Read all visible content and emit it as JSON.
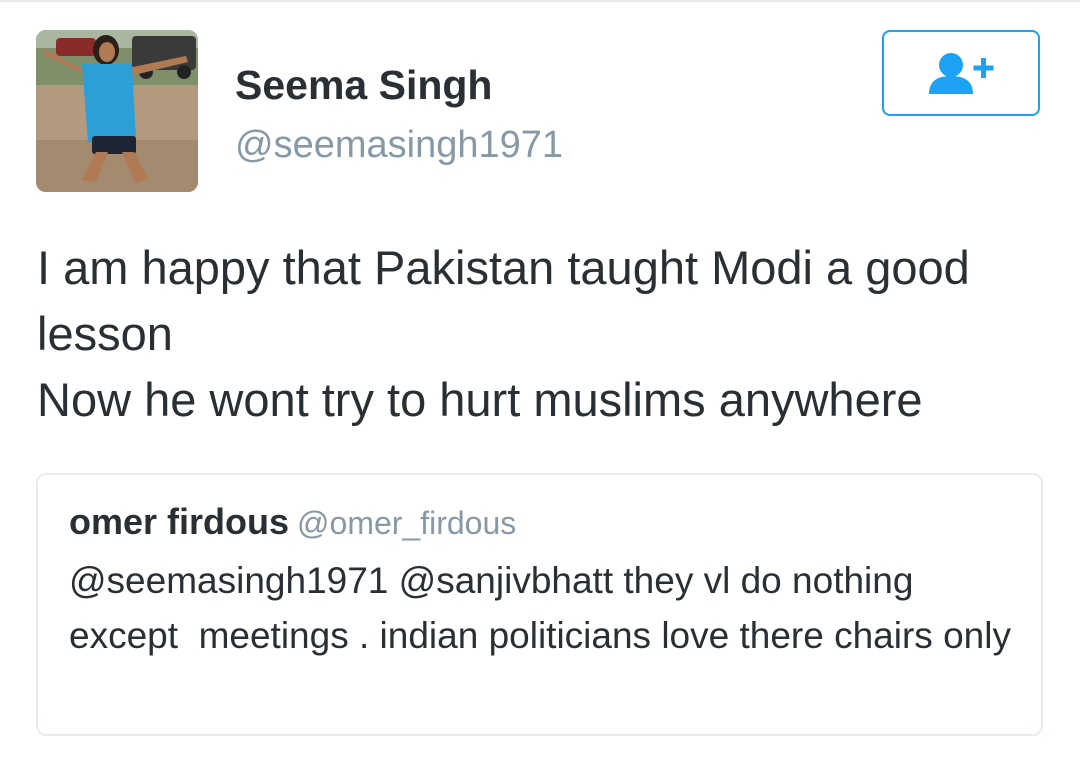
{
  "tweet": {
    "author": {
      "display_name": "Seema Singh",
      "handle": "@seemasingh1971",
      "avatar": "profile-photo"
    },
    "follow_button": {
      "icon": "add-user-icon",
      "color": "#1da1f2"
    },
    "text": "I am happy that Pakistan taught Modi a good lesson\nNow he wont try to hurt muslims anywhere",
    "quoted_tweet": {
      "display_name": "omer firdous",
      "handle": "@omer_firdous",
      "text": "@seemasingh1971 @sanjivbhatt they vl do nothing except  meetings . indian politicians love there chairs only"
    }
  },
  "colors": {
    "text_primary": "#292f33",
    "text_secondary": "#8899a6",
    "accent": "#1da1f2",
    "border": "#e6ecf0"
  }
}
